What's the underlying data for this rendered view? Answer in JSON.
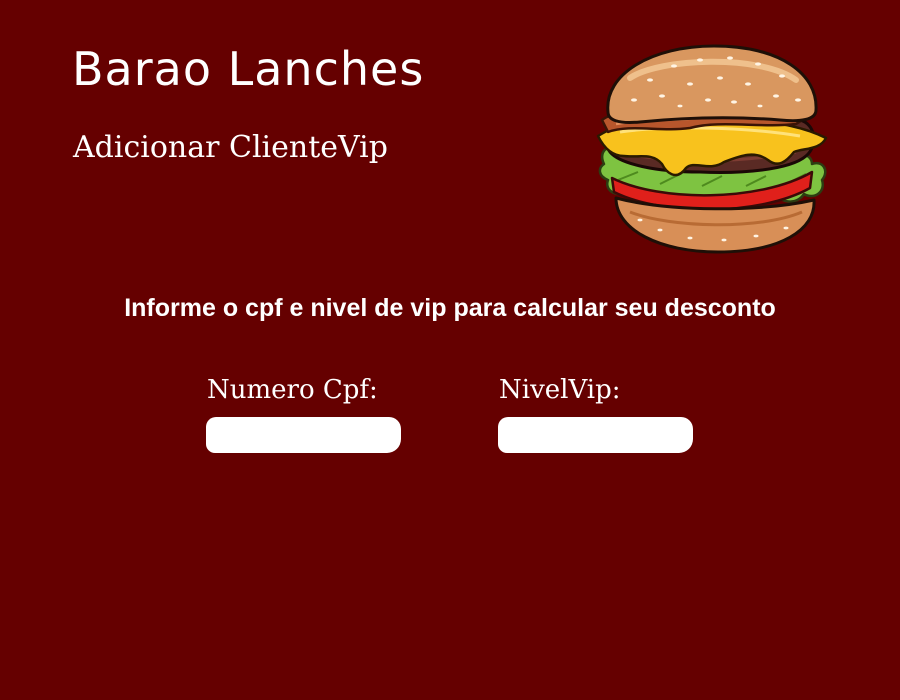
{
  "app": {
    "title": "Barao Lanches",
    "subtitle": "Adicionar ClienteVip"
  },
  "instruction": "Informe o cpf e nivel de vip para calcular seu desconto",
  "form": {
    "cpf": {
      "label": "Numero Cpf:",
      "value": "",
      "placeholder": ""
    },
    "nivel_vip": {
      "label": "NivelVip:",
      "value": "",
      "placeholder": ""
    }
  },
  "illustration": {
    "icon": "burger-illustration"
  },
  "colors": {
    "background": "#650000",
    "text": "#ffffff",
    "input_background": "#ffffff"
  }
}
